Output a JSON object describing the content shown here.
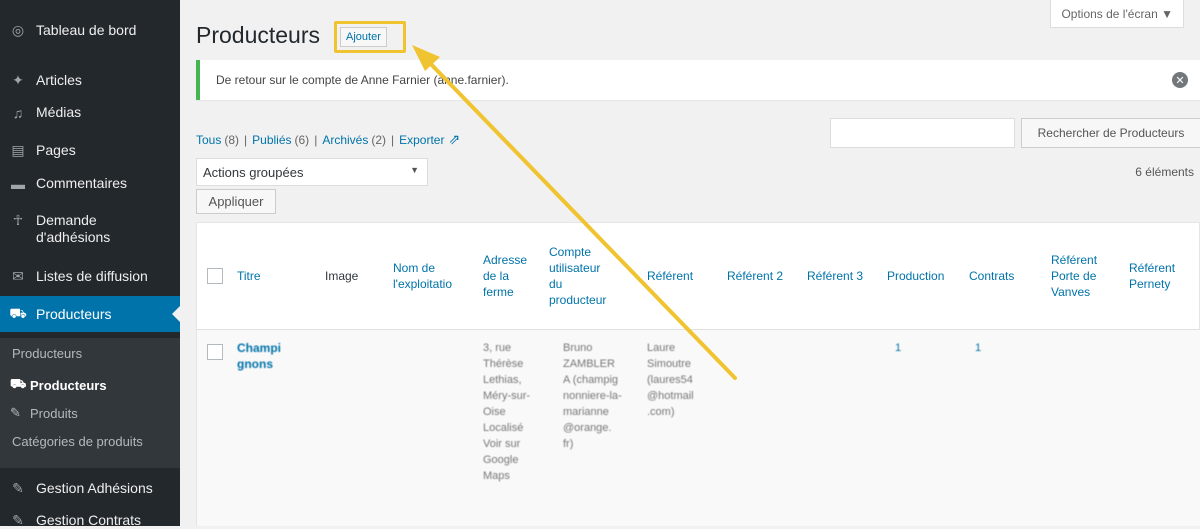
{
  "sidebar": {
    "items": [
      {
        "label": "Tableau de bord",
        "icon": "dashboard-icon"
      },
      {
        "label": "Articles",
        "icon": "pin-icon"
      },
      {
        "label": "Médias",
        "icon": "media-icon"
      },
      {
        "label": "Pages",
        "icon": "pages-icon"
      },
      {
        "label": "Commentaires",
        "icon": "comments-icon"
      },
      {
        "label": "Demande d'adhésions",
        "icon": "person-icon"
      },
      {
        "label": "Listes de diffusion",
        "icon": "mail-icon"
      },
      {
        "label": "Producteurs",
        "icon": "tractor-icon"
      }
    ],
    "submenu": [
      {
        "label": "Producteurs"
      },
      {
        "label": "Producteurs"
      },
      {
        "label": "Produits"
      },
      {
        "label": "Catégories de produits"
      }
    ],
    "bottom_items": [
      {
        "label": "Gestion Adhésions",
        "icon": "edit-icon"
      },
      {
        "label": "Gestion Contrats",
        "icon": "edit-icon"
      }
    ]
  },
  "header": {
    "title": "Producteurs",
    "add_label": "Ajouter",
    "screen_options": "Options de l'écran ▼"
  },
  "notice": {
    "text": "De retour sur le compte de Anne Farnier (anne.farnier).",
    "close": "✕"
  },
  "filters": {
    "all": "Tous",
    "all_count": "(8)",
    "published": "Publiés",
    "published_count": "(6)",
    "archived": "Archivés",
    "archived_count": "(2)",
    "export": "Exporter",
    "sep": "|"
  },
  "search": {
    "placeholder": "",
    "button": "Rechercher de Producteurs"
  },
  "bulk": {
    "selected": "Actions groupées",
    "apply": "Appliquer",
    "count": "6 éléments"
  },
  "table": {
    "headers": {
      "title": "Titre",
      "image": "Image",
      "farm_name": "Nom de l'exploitatio",
      "address": "Adresse de la ferme",
      "account": "Compte utilisateur du producteur",
      "ref1": "Référent",
      "ref2": "Référent 2",
      "ref3": "Référent 3",
      "production": "Production",
      "contracts": "Contrats",
      "ref_vanves": "Référent Porte de Vanves",
      "ref_pernety": "Référent Pernety"
    },
    "row": {
      "title": "Champi gnons",
      "address": "3, rue Thérèse Lethias, Méry-sur-Oise Localisé Voir sur Google Maps",
      "account": "Bruno ZAMBLER A (champig nonniere-la-marianne @orange. fr)",
      "ref1": "Laure Simoutre (laures54 @hotmail .com)",
      "production": "1",
      "contracts": "1"
    }
  },
  "annotation": {
    "arrow_color": "#f0c330"
  }
}
